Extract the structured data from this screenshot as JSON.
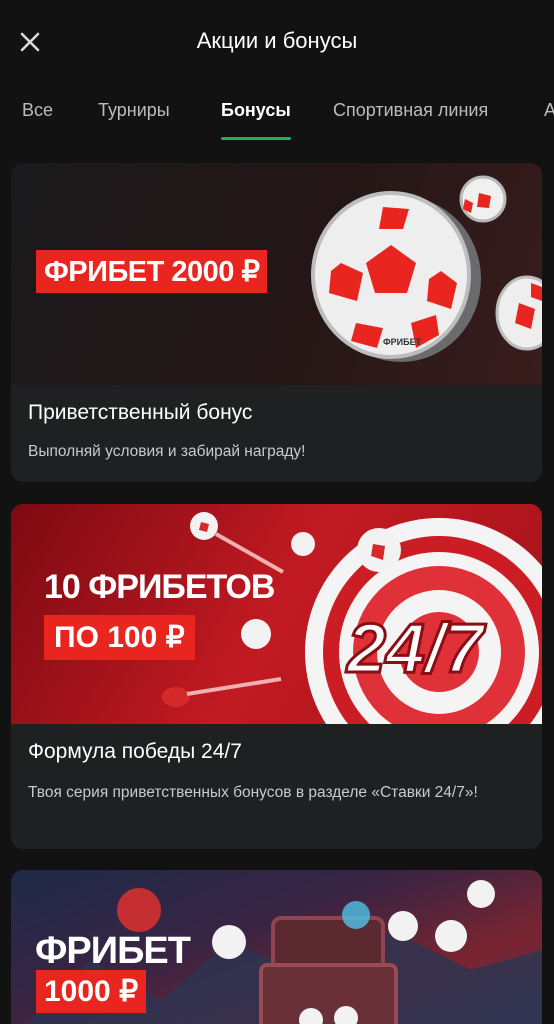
{
  "header": {
    "title": "Акции и бонусы",
    "close_icon": "close-icon"
  },
  "tabs": [
    {
      "label": "Все",
      "active": false
    },
    {
      "label": "Турниры",
      "active": false
    },
    {
      "label": "Бонусы",
      "active": true
    },
    {
      "label": "Спортивная линия",
      "active": false
    },
    {
      "label": "А",
      "active": false
    }
  ],
  "colors": {
    "background": "#121212",
    "card": "#1f2022",
    "accent_green": "#1fae62",
    "promo_red": "#e8261f"
  },
  "promos": [
    {
      "banner_badge": "ФРИБЕТ 2000 ₽",
      "coin_text": "ФРИБЕТ",
      "title": "Приветственный бонус",
      "description": "Выполняй условия и забирай награду!"
    },
    {
      "banner_headline": "10 ФРИБЕТОВ",
      "banner_badge": "ПО 100 ₽",
      "banner_art_text": "24/7",
      "title": "Формула победы 24/7",
      "description": "Твоя серия приветственных бонусов в разделе «Ставки 24/7»!"
    },
    {
      "banner_headline": "ФРИБЕТ",
      "banner_badge": "1000 ₽"
    }
  ]
}
